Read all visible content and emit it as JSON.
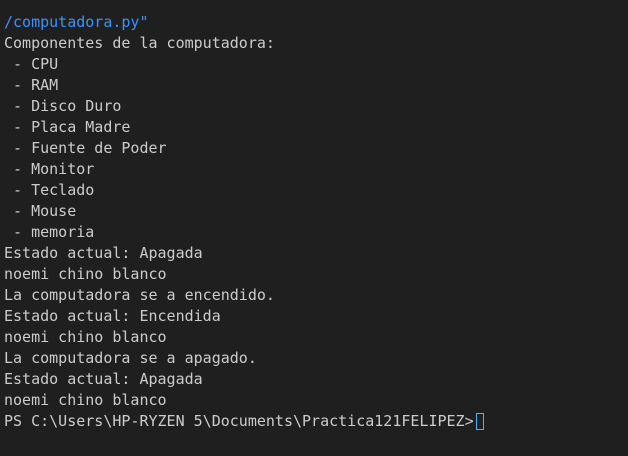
{
  "colors": {
    "background": "#1f1f1f",
    "text": "#cccccc",
    "path_text": "#3794ff",
    "cursor": "#3fb5ff"
  },
  "terminal": {
    "lines": [
      "/computadora.py\"",
      "Componentes de la computadora:",
      " - CPU",
      " - RAM",
      " - Disco Duro",
      " - Placa Madre",
      " - Fuente de Poder",
      " - Monitor",
      " - Teclado",
      " - Mouse",
      " - memoria",
      "Estado actual: Apagada",
      "noemi chino blanco",
      "La computadora se a encendido.",
      "Estado actual: Encendida",
      "noemi chino blanco",
      "La computadora se a apagado.",
      "Estado actual: Apagada",
      "noemi chino blanco"
    ],
    "prompt": "PS C:\\Users\\HP-RYZEN 5\\Documents\\Practica121FELIPEZ>",
    "cursor_icon": "text-cursor-icon"
  }
}
